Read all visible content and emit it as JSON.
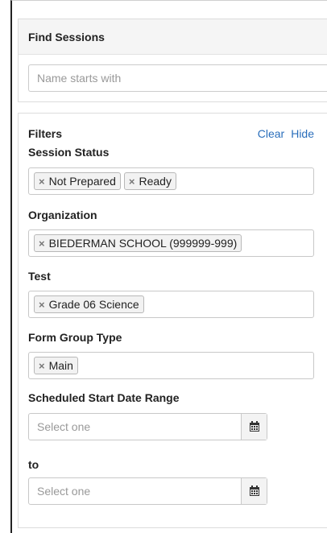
{
  "find_sessions": {
    "title": "Find Sessions",
    "search_placeholder": "Name starts with"
  },
  "filters": {
    "title": "Filters",
    "clear_label": "Clear",
    "hide_label": "Hide",
    "session_status": {
      "label": "Session Status",
      "tags": [
        "Not Prepared",
        "Ready"
      ]
    },
    "organization": {
      "label": "Organization",
      "tags": [
        "BIEDERMAN SCHOOL (999999-999)"
      ]
    },
    "test": {
      "label": "Test",
      "tags": [
        "Grade 06 Science"
      ]
    },
    "form_group_type": {
      "label": "Form Group Type",
      "tags": [
        "Main"
      ]
    },
    "date_range": {
      "label": "Scheduled Start Date Range",
      "start_placeholder": "Select one",
      "to_label": "to",
      "end_placeholder": "Select one"
    }
  },
  "icons": {
    "tag_remove": "×",
    "calendar": "calendar-icon"
  }
}
